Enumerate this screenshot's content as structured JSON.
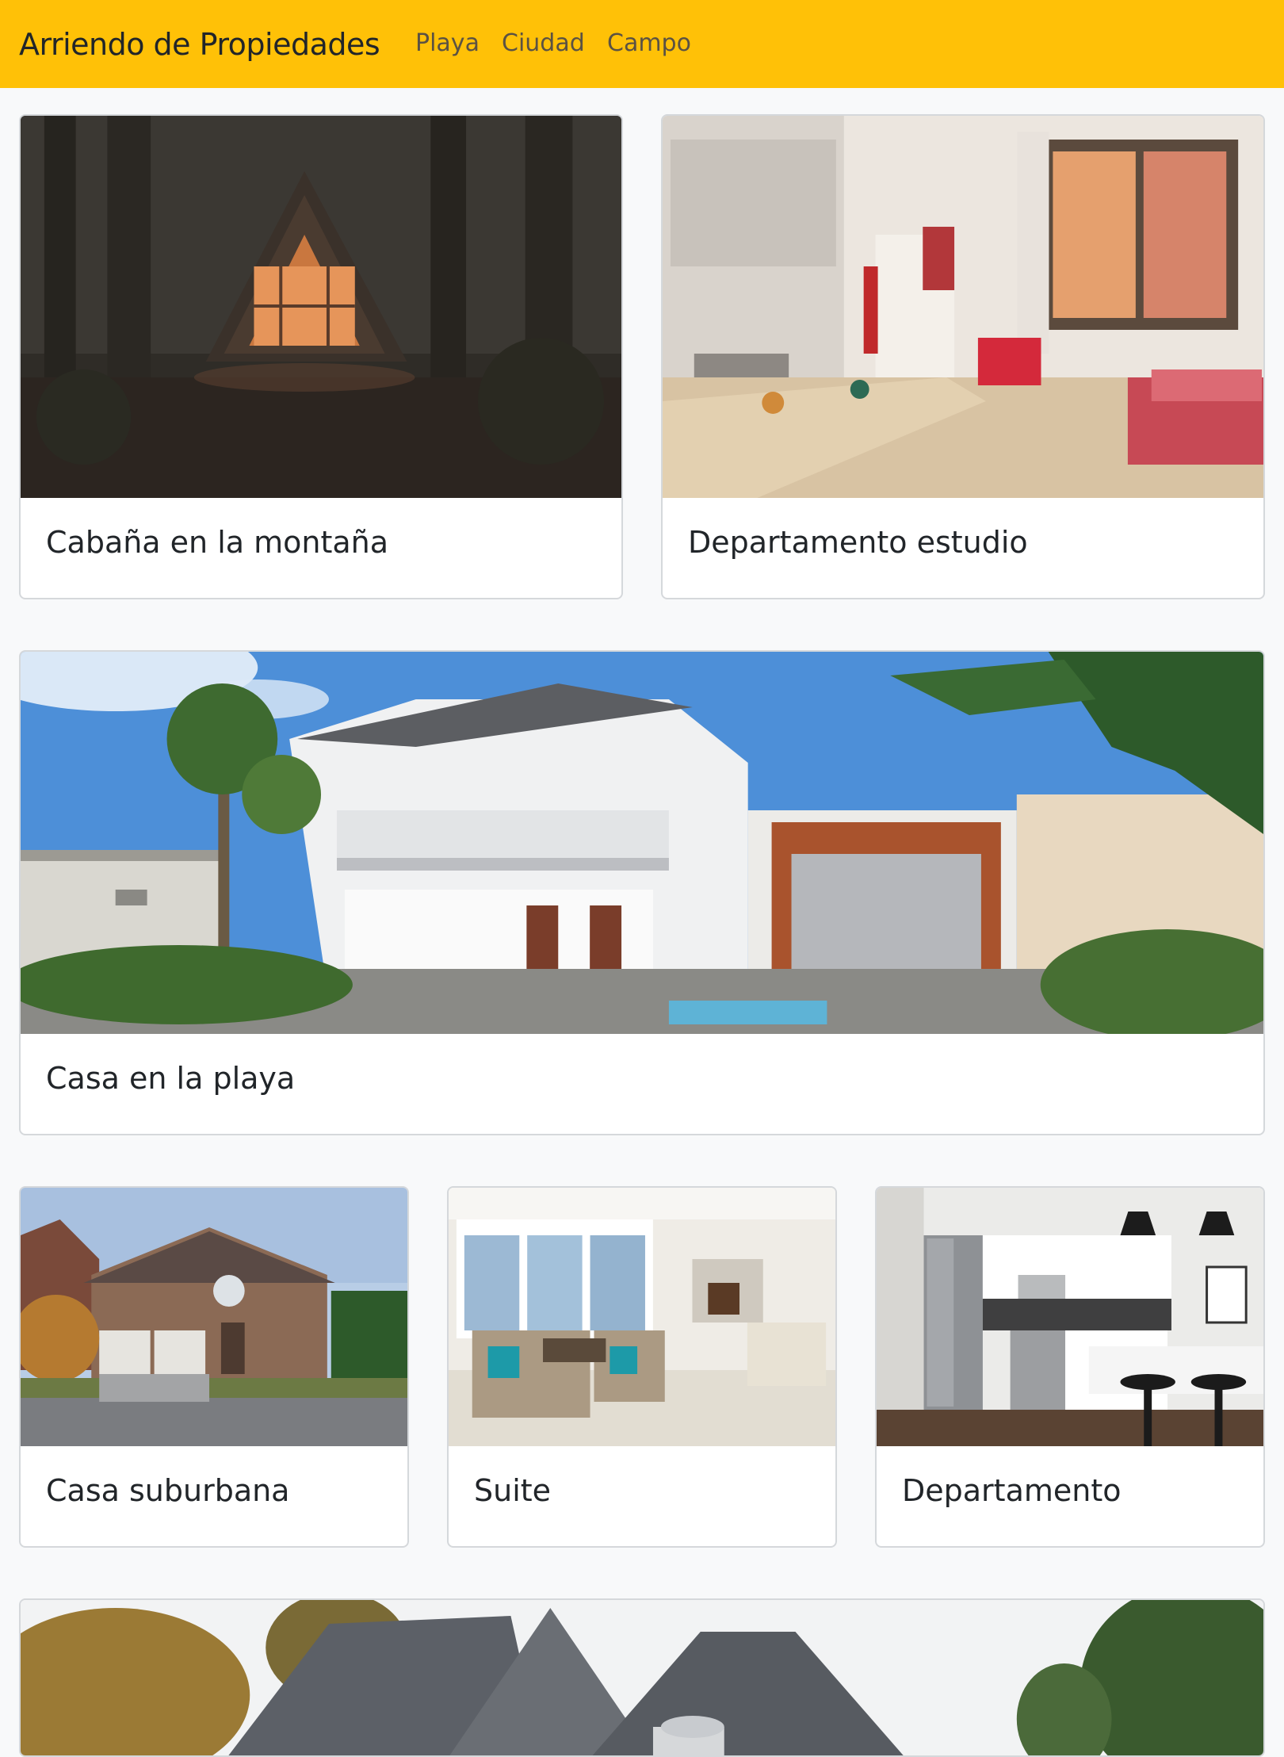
{
  "navbar": {
    "brand": "Arriendo de Propiedades",
    "links": [
      "Playa",
      "Ciudad",
      "Campo"
    ],
    "background": "#ffc107"
  },
  "cards": [
    {
      "title": "Cabaña en la montaña",
      "image": "a-frame-cabin-in-forest-photo"
    },
    {
      "title": "Departamento estudio",
      "image": "studio-apartment-interior-photo"
    },
    {
      "title": "Casa en la playa",
      "image": "white-beach-house-with-palms-photo"
    },
    {
      "title": "Casa suburbana",
      "image": "suburban-brick-house-photo"
    },
    {
      "title": "Suite",
      "image": "living-room-suite-photo"
    },
    {
      "title": "Departamento",
      "image": "modern-kitchen-photo"
    },
    {
      "title": "",
      "image": "large-house-with-trees-photo"
    }
  ]
}
